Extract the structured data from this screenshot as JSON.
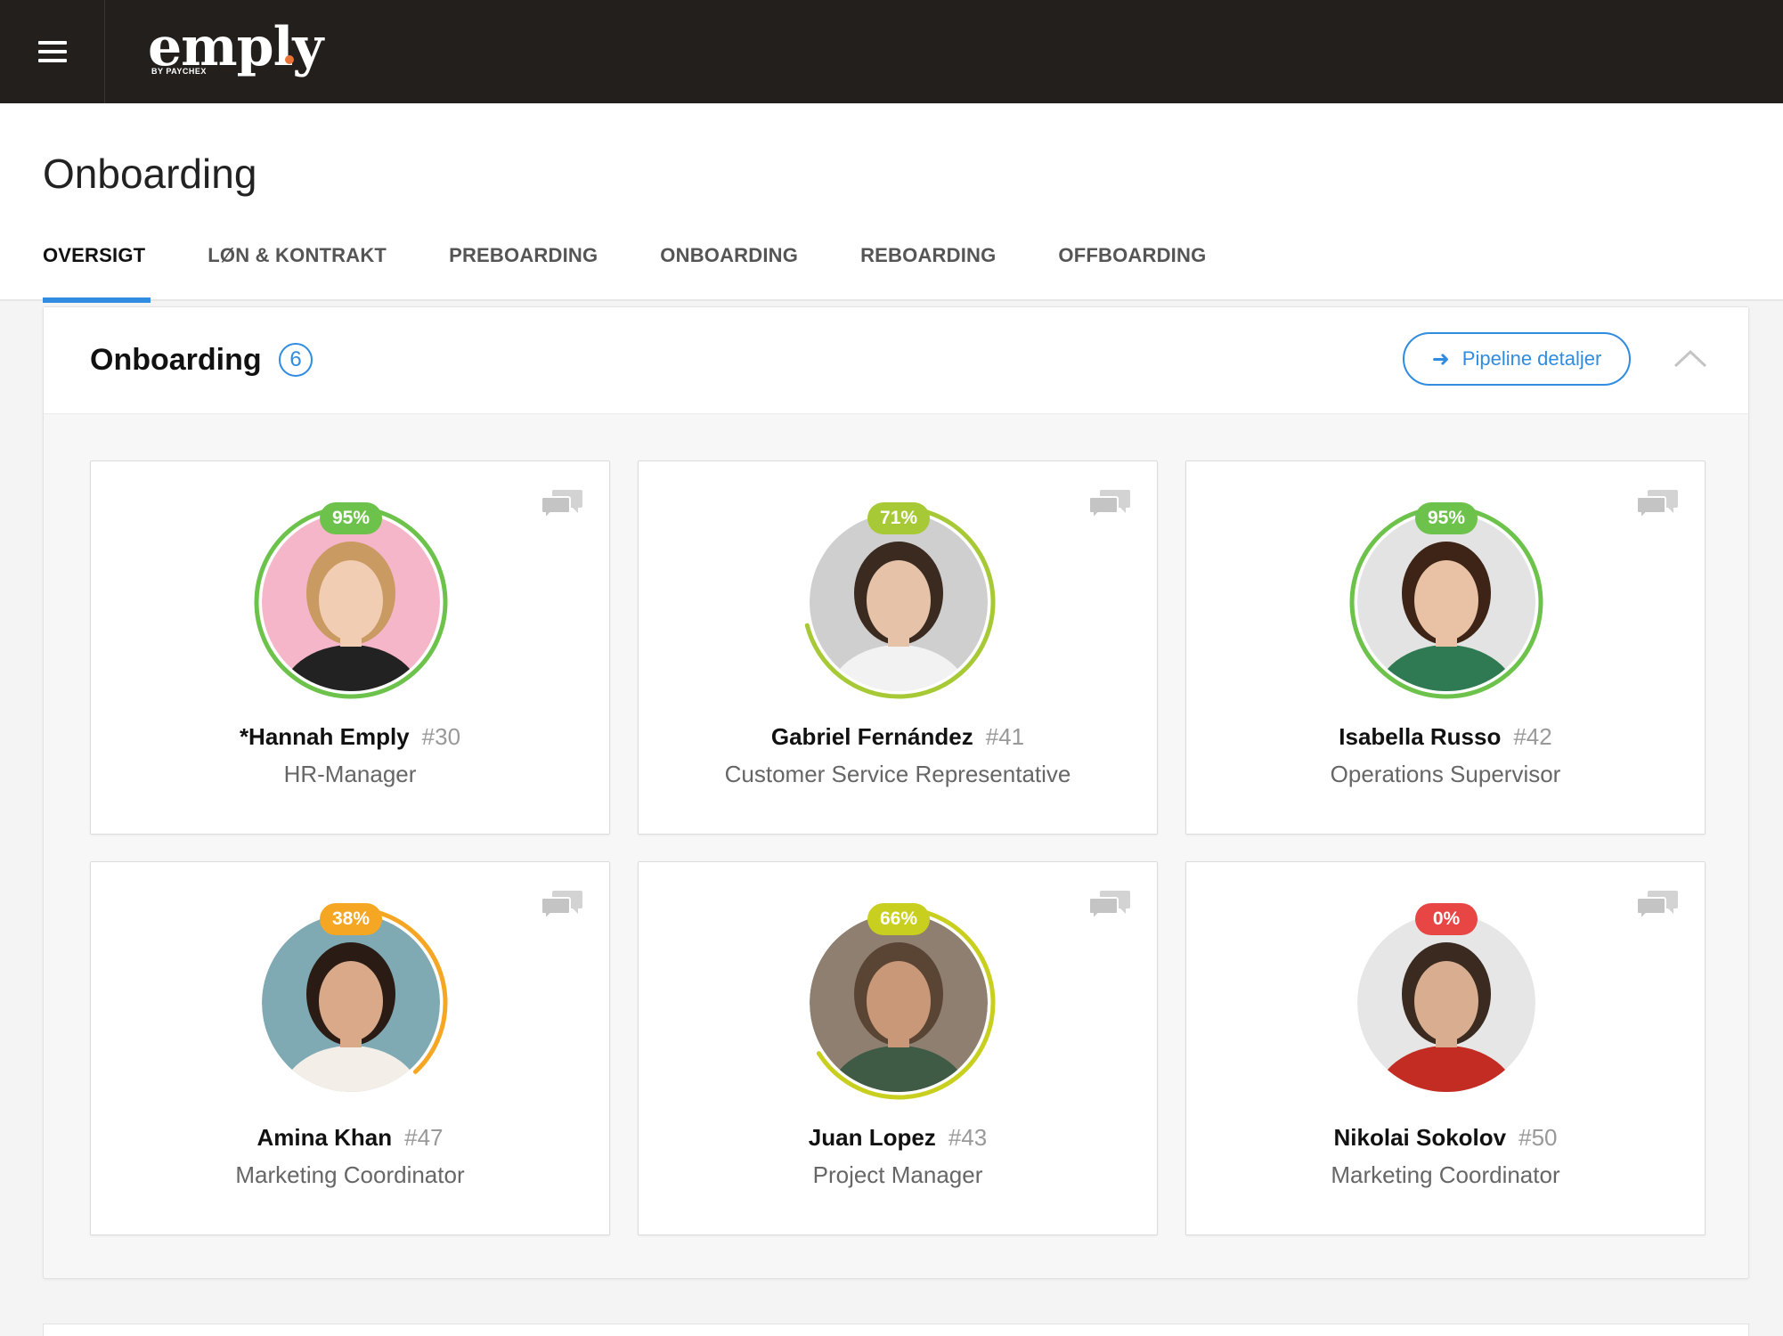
{
  "app": {
    "logo_text": "emply",
    "logo_sub": "BY PAYCHEX",
    "brand_accent": "#e8743b"
  },
  "header": {
    "title": "Onboarding",
    "tabs": [
      {
        "label": "OVERSIGT",
        "active": true
      },
      {
        "label": "LØN & KONTRAKT",
        "active": false
      },
      {
        "label": "PREBOARDING",
        "active": false
      },
      {
        "label": "ONBOARDING",
        "active": false
      },
      {
        "label": "REBOARDING",
        "active": false
      },
      {
        "label": "OFFBOARDING",
        "active": false
      }
    ]
  },
  "panel": {
    "title": "Onboarding",
    "count": "6",
    "pipeline_label": "Pipeline detaljer"
  },
  "cards": [
    {
      "name": "*Hannah Emply",
      "number": "#30",
      "role": "HR-Manager",
      "progress_label": "95%",
      "progress": 95,
      "color": "#6cc24a",
      "avatar_bg": "#f4b6c8",
      "skin": "#f1cdb3",
      "hair": "#c99a62",
      "shirt": "#222222"
    },
    {
      "name": "Gabriel Fernández",
      "number": "#41",
      "role": "Customer Service Representative",
      "progress_label": "71%",
      "progress": 71,
      "color": "#a6c935",
      "avatar_bg": "#cfcfcf",
      "skin": "#e6c3a8",
      "hair": "#3a2a20",
      "shirt": "#f2f2f2"
    },
    {
      "name": "Isabella Russo",
      "number": "#42",
      "role": "Operations Supervisor",
      "progress_label": "95%",
      "progress": 95,
      "color": "#6cc24a",
      "avatar_bg": "#e3e3e3",
      "skin": "#e9c1a4",
      "hair": "#3d2417",
      "shirt": "#2f7a52"
    },
    {
      "name": "Amina Khan",
      "number": "#47",
      "role": "Marketing Coordinator",
      "progress_label": "38%",
      "progress": 38,
      "color": "#f5a623",
      "avatar_bg": "#7fa9b3",
      "skin": "#d9a98a",
      "hair": "#2a1b14",
      "shirt": "#f3efe8"
    },
    {
      "name": "Juan Lopez",
      "number": "#43",
      "role": "Project Manager",
      "progress_label": "66%",
      "progress": 66,
      "color": "#c9cf1f",
      "avatar_bg": "#8f7f70",
      "skin": "#c99878",
      "hair": "#5a4535",
      "shirt": "#3f5a45"
    },
    {
      "name": "Nikolai Sokolov",
      "number": "#50",
      "role": "Marketing Coordinator",
      "progress_label": "0%",
      "progress": 0,
      "color": "#e84545",
      "avatar_bg": "#e6e6e6",
      "skin": "#d9ae90",
      "hair": "#3a2a20",
      "shirt": "#c22c22"
    }
  ]
}
